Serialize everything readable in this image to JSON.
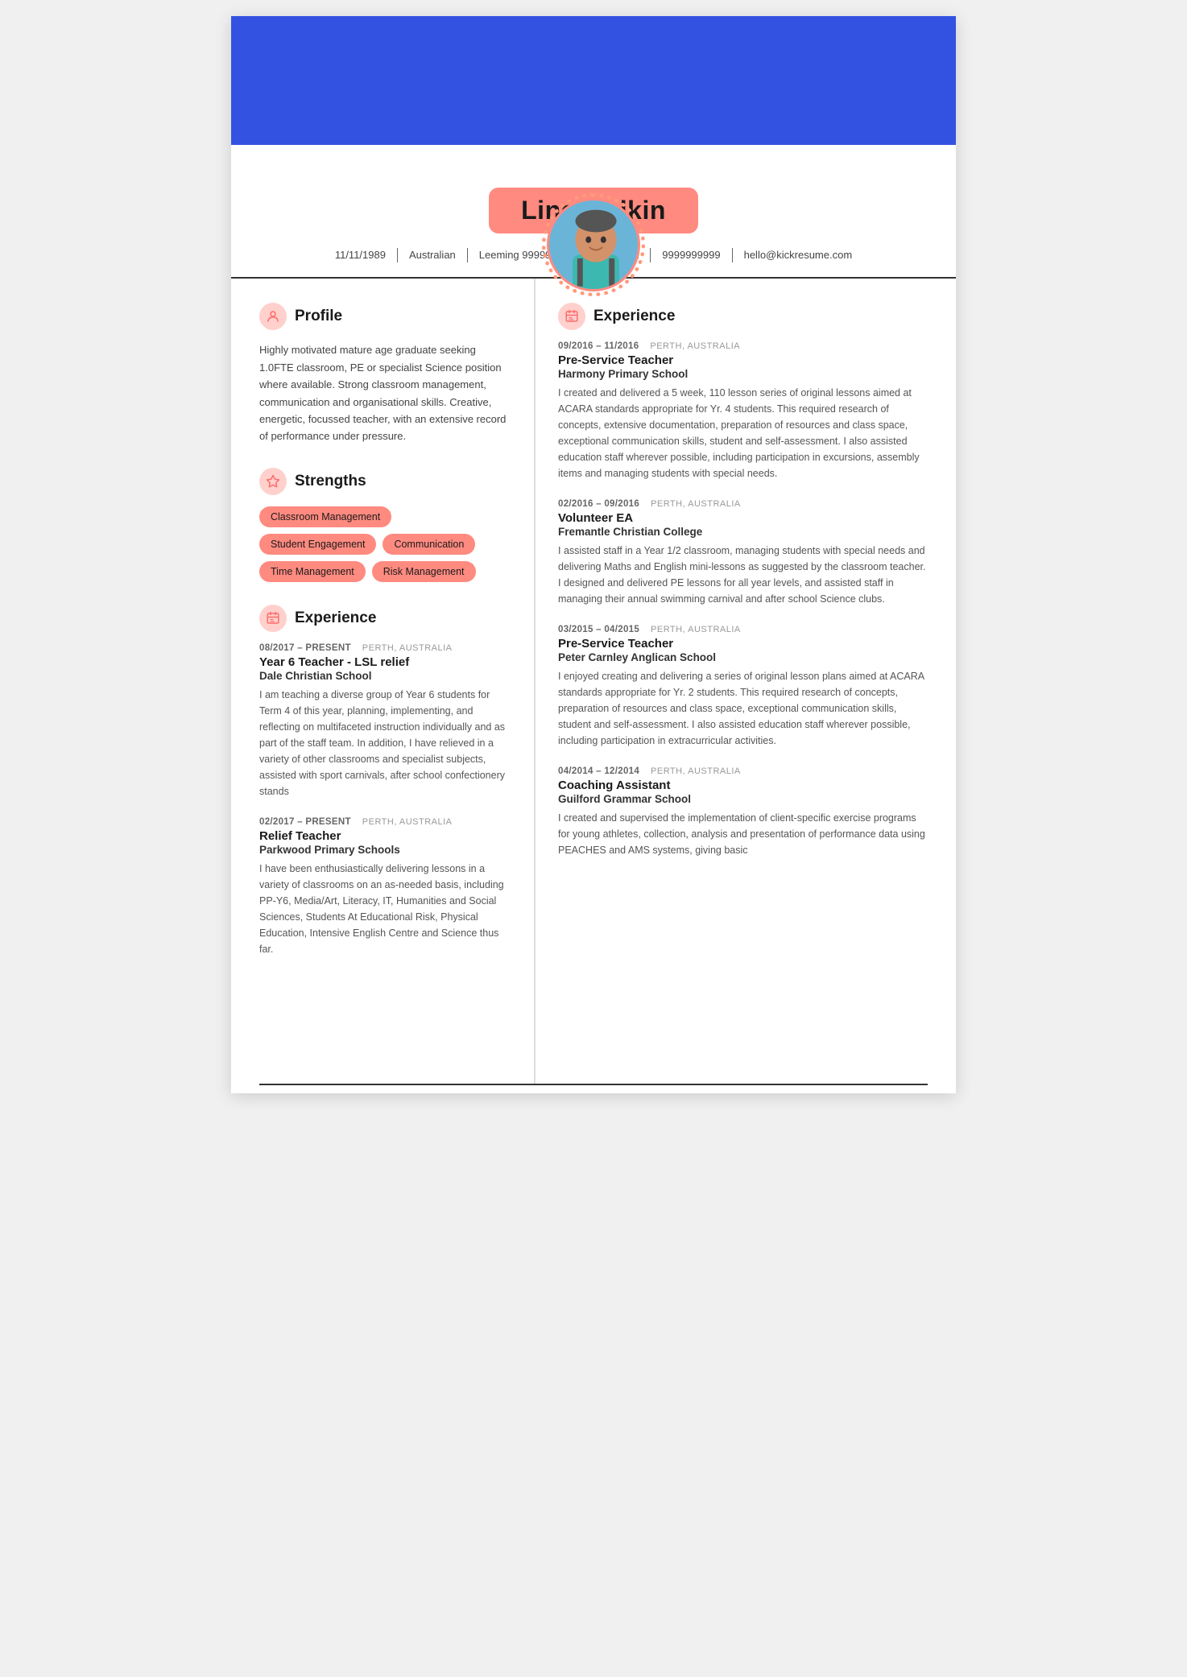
{
  "header": {
    "bg_color": "#3352E1",
    "name": "Line Malkin",
    "badge_color": "#FF8A80"
  },
  "contact": {
    "dob": "11/11/1989",
    "nationality": "Australian",
    "address": "Leeming 99999, Western Australia",
    "phone": "9999999999",
    "email": "hello@kickresume.com"
  },
  "left": {
    "profile": {
      "section_title": "Profile",
      "text": "Highly motivated mature age graduate seeking 1.0FTE classroom, PE or specialist Science position where available. Strong classroom management, communication and organisational skills. Creative, energetic, focussed teacher, with an extensive record of performance under pressure."
    },
    "strengths": {
      "section_title": "Strengths",
      "badges": [
        "Classroom Management",
        "Student Engagement",
        "Communication",
        "Time Management",
        "Risk Management"
      ]
    },
    "experience": {
      "section_title": "Experience",
      "entries": [
        {
          "date": "08/2017 – PRESENT",
          "location": "PERTH, AUSTRALIA",
          "title": "Year 6 Teacher - LSL relief",
          "company": "Dale Christian School",
          "desc": "I am teaching a diverse group of Year 6 students for Term 4 of this year, planning, implementing, and reflecting on multifaceted instruction individually and as part of the staff team. In addition, I have relieved in a variety of other classrooms and specialist subjects, assisted with sport carnivals, after school confectionery stands"
        },
        {
          "date": "02/2017 – PRESENT",
          "location": "PERTH, AUSTRALIA",
          "title": "Relief Teacher",
          "company": "Parkwood Primary Schools",
          "desc": "I have been enthusiastically delivering lessons in a variety of classrooms on an as-needed basis, including PP-Y6, Media/Art, Literacy, IT, Humanities and Social Sciences, Students At Educational Risk, Physical Education, Intensive English Centre and Science thus far."
        }
      ]
    }
  },
  "right": {
    "experience": {
      "section_title": "Experience",
      "entries": [
        {
          "date": "09/2016 – 11/2016",
          "location": "PERTH, AUSTRALIA",
          "title": "Pre-Service Teacher",
          "company": "Harmony Primary School",
          "desc": "I created and delivered a 5 week, 110 lesson series of original lessons aimed at ACARA standards appropriate for Yr. 4 students. This required research of concepts, extensive documentation, preparation of resources and class space, exceptional communication skills, student and self-assessment. I also assisted education staff wherever possible, including participation in excursions, assembly items and managing students with special needs."
        },
        {
          "date": "02/2016 – 09/2016",
          "location": "PERTH, AUSTRALIA",
          "title": "Volunteer EA",
          "company": "Fremantle Christian College",
          "desc": "I assisted staff in a Year 1/2 classroom, managing students with special needs and delivering Maths and English mini-lessons as suggested by the classroom teacher. I designed and delivered PE lessons for all year levels, and assisted staff in managing their annual swimming carnival and after school Science clubs."
        },
        {
          "date": "03/2015 – 04/2015",
          "location": "PERTH, AUSTRALIA",
          "title": "Pre-Service Teacher",
          "company": "Peter Carnley Anglican School",
          "desc": "I enjoyed creating and delivering a series of original lesson plans aimed at ACARA standards appropriate for Yr. 2 students. This required research of concepts, preparation of resources and class space, exceptional communication skills, student and self-assessment. I also assisted education staff wherever possible, including participation in extracurricular activities."
        },
        {
          "date": "04/2014 – 12/2014",
          "location": "PERTH, AUSTRALIA",
          "title": "Coaching Assistant",
          "company": "Guilford Grammar School",
          "desc": "I created and supervised the implementation of client-specific exercise programs for young athletes, collection, analysis and presentation of performance data using PEACHES and AMS systems, giving basic"
        }
      ]
    }
  },
  "icons": {
    "profile": "👤",
    "strengths": "⭐",
    "experience": "📋"
  }
}
